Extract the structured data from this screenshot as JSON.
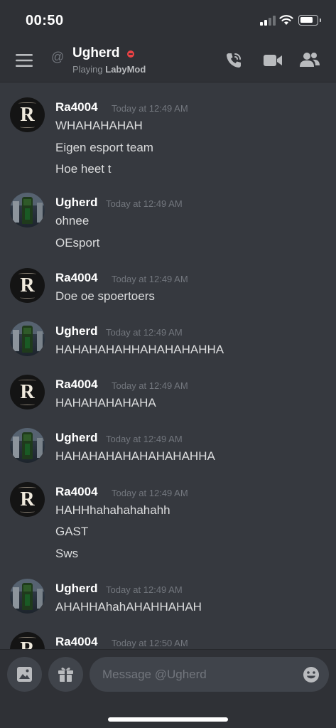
{
  "status_bar": {
    "time": "00:50"
  },
  "header": {
    "channel_name": "Ugherd",
    "activity_prefix": "Playing",
    "activity_game": "LabyMod"
  },
  "composer": {
    "placeholder": "Message @Ugherd"
  },
  "messages": [
    {
      "author": "Ra4004",
      "timestamp": "Today at 12:49 AM",
      "lines": [
        "WHAHAHAHAH",
        "Eigen esport team",
        "Hoe heet t"
      ]
    },
    {
      "author": "Ugherd",
      "timestamp": "Today at 12:49 AM",
      "lines": [
        "ohnee",
        "OEsport"
      ]
    },
    {
      "author": "Ra4004",
      "timestamp": "Today at 12:49 AM",
      "lines": [
        "Doe oe spoertoers"
      ]
    },
    {
      "author": "Ugherd",
      "timestamp": "Today at 12:49 AM",
      "lines": [
        "HAHAHAHAHHAHAHAHAHHA"
      ]
    },
    {
      "author": "Ra4004",
      "timestamp": "Today at 12:49 AM",
      "lines": [
        "HAHAHAHAHAHA"
      ]
    },
    {
      "author": "Ugherd",
      "timestamp": "Today at 12:49 AM",
      "lines": [
        "HAHAHAHAHAHAHAHAHHA"
      ]
    },
    {
      "author": "Ra4004",
      "timestamp": "Today at 12:49 AM",
      "lines": [
        "HAHHhahahahahahh",
        "GAST",
        "Sws"
      ]
    },
    {
      "author": "Ugherd",
      "timestamp": "Today at 12:49 AM",
      "lines": [
        "AHAHHAhahAHAHHAHAH"
      ]
    },
    {
      "author": "Ra4004",
      "timestamp": "Today at 12:50 AM",
      "lines": []
    }
  ],
  "avatars": {
    "Ra4004": "R"
  },
  "colors": {
    "background": "#36393f",
    "header": "#2f3136",
    "input": "#40444b",
    "dnd_status": "#ed4245"
  }
}
